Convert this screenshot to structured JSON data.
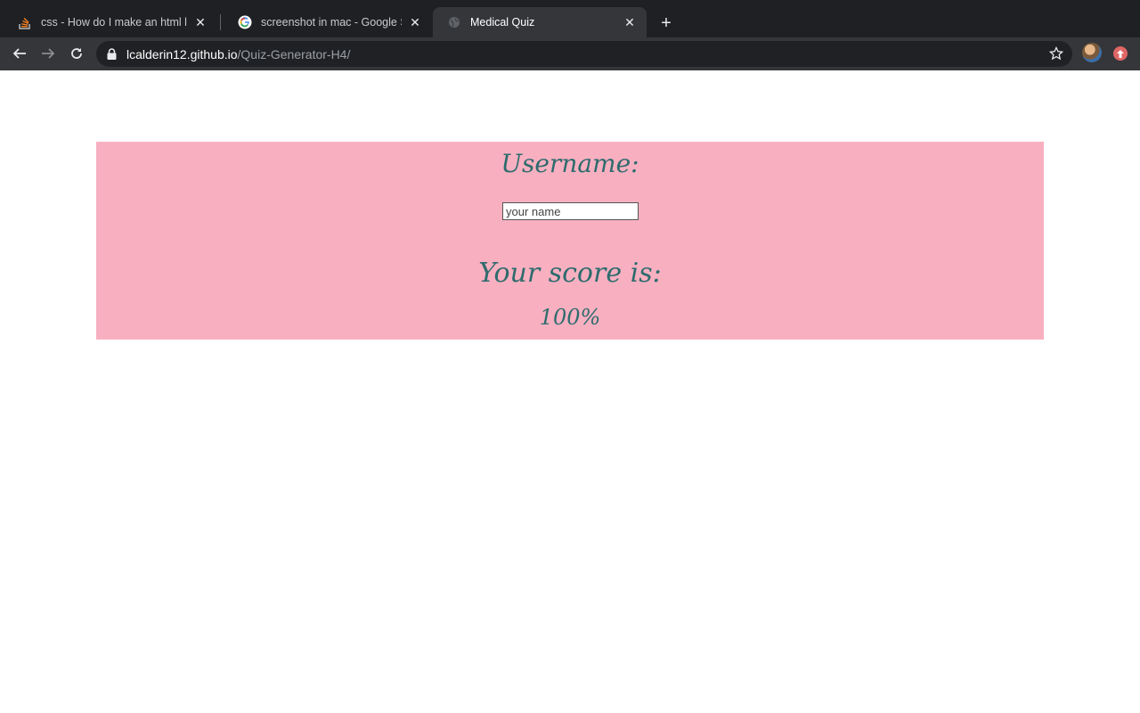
{
  "browser": {
    "tabs": [
      {
        "title": "css - How do I make an html lir",
        "icon": "stackoverflow-icon"
      },
      {
        "title": "screenshot in mac - Google Se",
        "icon": "google-icon"
      },
      {
        "title": "Medical Quiz",
        "icon": "globe-icon",
        "active": true
      }
    ],
    "url_host": "lcalderin12.github.io",
    "url_path": "/Quiz-Generator-H4/"
  },
  "quiz": {
    "username_heading": "Username:",
    "name_placeholder": "your name",
    "score_heading": "Your score is:",
    "score_value": "100%"
  },
  "colors": {
    "panel_bg": "#f8b0c0",
    "heading_text": "#2e6b6e",
    "tabstrip_bg": "#1f2023",
    "toolbar_bg": "#35363a"
  }
}
